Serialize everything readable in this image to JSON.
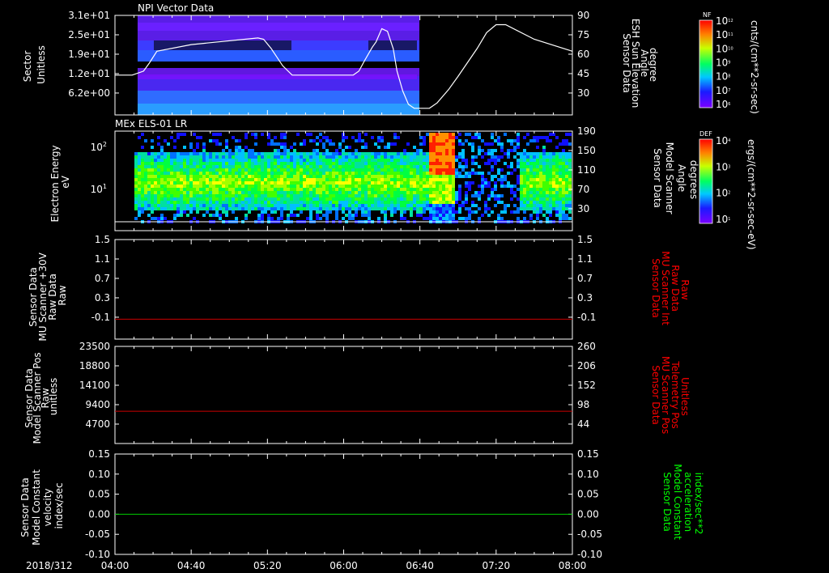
{
  "chart_data": [
    {
      "type": "heatmap",
      "title": "NPI Vector Data",
      "ylabel_left": [
        "Sector",
        "Unitless"
      ],
      "ylabel_right": [
        "Sensor Data",
        "ESH Sun Elevation",
        "Angle",
        "degree"
      ],
      "yticks_left": [
        "3.1e+01",
        "2.5e+01",
        "1.9e+01",
        "1.2e+01",
        "6.2e+00"
      ],
      "yticks_right": [
        "90",
        "75",
        "60",
        "45",
        "30"
      ],
      "ylim_right": [
        15,
        90
      ],
      "colorbar": {
        "label": "NF",
        "units": "cnts/(cm**2-sr-sec)",
        "ticks": [
          "10^12",
          "10^11",
          "10^10",
          "10^9",
          "10^8",
          "10^7",
          "10^6"
        ]
      },
      "data_coverage": {
        "start": "04:09",
        "end": "06:40"
      },
      "sun_elevation_curve": {
        "x": [
          "04:00",
          "04:09",
          "04:15",
          "04:18",
          "04:22",
          "04:40",
          "05:15",
          "05:18",
          "05:22",
          "05:28",
          "05:33",
          "06:05",
          "06:08",
          "06:11",
          "06:15",
          "06:17",
          "06:20",
          "06:23",
          "06:26",
          "06:28",
          "06:31",
          "06:34",
          "06:37",
          "06:41",
          "06:45",
          "06:49",
          "06:55",
          "07:00",
          "07:10",
          "07:15",
          "07:20",
          "07:25",
          "07:40",
          "08:00"
        ],
        "y": [
          45,
          45,
          48,
          54,
          63,
          68,
          73,
          72,
          65,
          52,
          45,
          45,
          48,
          56,
          66,
          70,
          80,
          78,
          65,
          48,
          33,
          23,
          20,
          20,
          20,
          24,
          34,
          44,
          65,
          77,
          83,
          83,
          72,
          63
        ]
      }
    },
    {
      "type": "heatmap",
      "title": "MEx ELS-01 LR",
      "ylabel_left": [
        "Electron Energy",
        "eV"
      ],
      "ylabel_right": [
        "Sensor Data",
        "Model Scanner",
        "Angle",
        "degrees"
      ],
      "yticks_left": [
        "10^2",
        "10^1"
      ],
      "yticks_right": [
        "190",
        "150",
        "110",
        "70",
        "30"
      ],
      "colorbar": {
        "label": "DEF",
        "units": "ergs/(cm**2-sr-sec-eV)",
        "ticks": [
          "10^4",
          "10^3",
          "10^2",
          "10^1"
        ]
      },
      "scanner_angle_constant": 10
    },
    {
      "type": "line",
      "ylabel_left": [
        "Sensor Data",
        "MU Scanner +30V",
        "Raw Data",
        "Raw"
      ],
      "ylabel_right": [
        "Sensor Data",
        "MU Scanner Int",
        "Raw Data",
        "Raw"
      ],
      "yticks_left": [
        "1.5",
        "1.1",
        "0.7",
        "0.3",
        "-0.1"
      ],
      "yticks_right": [
        "1.5",
        "1.1",
        "0.7",
        "0.3",
        "-0.1"
      ],
      "ylim": [
        -0.5,
        1.5
      ],
      "series": [
        {
          "color": "#cc0000",
          "x": [
            "04:00",
            "08:00"
          ],
          "y": [
            -0.1,
            -0.1
          ]
        }
      ]
    },
    {
      "type": "line",
      "ylabel_left": [
        "Sensor Data",
        "Model Scanner Pos",
        "Raw",
        "unitless"
      ],
      "ylabel_right": [
        "Sensor Data",
        "MU Scanner Pos",
        "Telemetry Pos",
        "Unitless"
      ],
      "yticks_left": [
        "23500",
        "18800",
        "14100",
        "9400",
        "4700"
      ],
      "yticks_right": [
        "260",
        "206",
        "152",
        "98",
        "44"
      ],
      "ylim": [
        0,
        23500
      ],
      "series": [
        {
          "color": "#cc0000",
          "x": [
            "04:00",
            "08:00"
          ],
          "y": [
            7800,
            7800
          ]
        }
      ]
    },
    {
      "type": "line",
      "ylabel_left": [
        "Sensor Data",
        "Model Constant",
        "velocity",
        "index/sec"
      ],
      "ylabel_right": [
        "Sensor Data",
        "Model Constant",
        "acceleration",
        "index/sec**2"
      ],
      "yticks_left": [
        "0.15",
        "0.10",
        "0.05",
        "0.00",
        "-0.05",
        "-0.10"
      ],
      "yticks_right": [
        "0.15",
        "0.10",
        "0.05",
        "0.00",
        "-0.05",
        "-0.10"
      ],
      "ylim": [
        -0.1,
        0.15
      ],
      "series": [
        {
          "color": "#00cc00",
          "x": [
            "04:00",
            "08:00"
          ],
          "y": [
            0,
            0
          ]
        }
      ]
    }
  ],
  "x_axis": {
    "date": "2018/312",
    "ticks": [
      "04:00",
      "04:40",
      "05:20",
      "06:00",
      "06:40",
      "07:20",
      "08:00"
    ]
  },
  "colors": {
    "line_red": "#cc0000",
    "line_green": "#00cc00",
    "label_red": "#ff0000",
    "label_green": "#00ff00"
  }
}
